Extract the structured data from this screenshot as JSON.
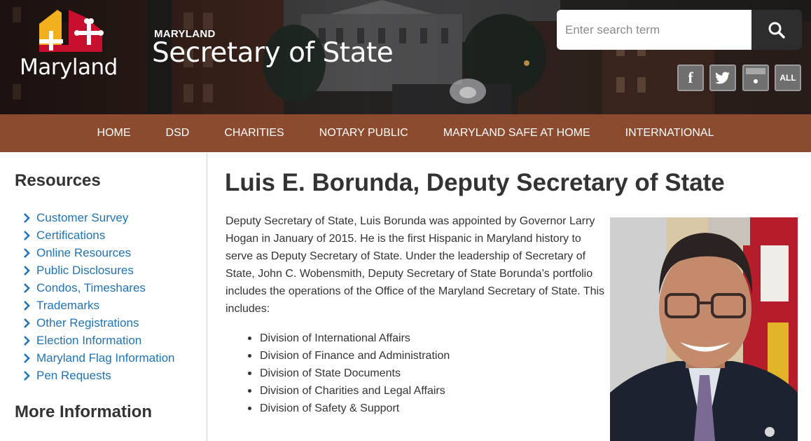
{
  "header": {
    "logo_word": "Maryland",
    "brand_small": "MARYLAND",
    "brand_big": "Secretary of State",
    "search": {
      "placeholder": "Enter search term"
    },
    "social": {
      "facebook": "f",
      "all": "ALL"
    }
  },
  "nav": {
    "items": [
      "HOME",
      "DSD",
      "CHARITIES",
      "NOTARY PUBLIC",
      "MARYLAND SAFE AT HOME",
      "INTERNATIONAL"
    ]
  },
  "sidebar": {
    "heading": "Resources",
    "links": [
      "Customer Survey",
      "Certifications",
      "Online Resources",
      "Public Disclosures",
      "Condos, Timeshares",
      "Trademarks",
      "Other Registrations",
      "Election Information",
      "Maryland Flag Information",
      "Pen Requests"
    ],
    "more_heading": "More Information"
  },
  "main": {
    "title": "Luis E. Borunda, Deputy Secretary of State",
    "intro": "Deputy Secretary of State, Luis Borunda was appointed by Governor Larry Hogan in January of 2015. He is the first Hispanic in Maryland history to serve as Deputy Secretary of State. Under the leadership of Secretary of State, John C. Wobensmith, Deputy Secretary of State Borunda’s portfolio includes the operations of the Office of the Maryland Secretary of State. This includes:",
    "divisions": [
      "Division of International Affairs",
      "Division of Finance and Administration",
      "Division of State Documents",
      "Division of Charities and Legal Affairs",
      "Division of Safety & Support"
    ]
  },
  "colors": {
    "nav_bg": "#8c4a2f",
    "link": "#1f73b6",
    "heading": "#333333",
    "search_button": "#2d2d2d"
  },
  "icons": [
    "maryland-flag-logo",
    "search-icon",
    "facebook-icon",
    "twitter-icon",
    "flickr-icon",
    "all-social-icon",
    "chevron-right-icon",
    "portrait-photo"
  ]
}
